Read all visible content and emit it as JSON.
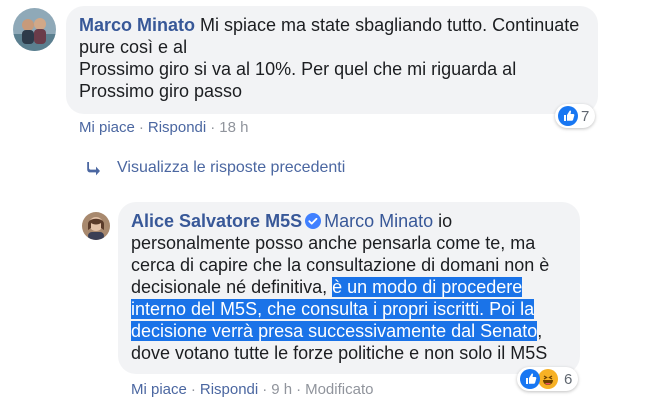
{
  "comment1": {
    "author": "Marco Minato",
    "line1": " Mi spiace ma state sbagliando tutto. Continuate",
    "line2": "pure così e al",
    "line3": "Prossimo giro si va al 10%. Per quel che mi riguarda al",
    "line4": "Prossimo giro passo",
    "reactions_count": "7",
    "actions": {
      "like": "Mi piace",
      "reply": "Rispondi",
      "time": "18 h"
    },
    "reaction_icons": [
      "like-icon"
    ]
  },
  "view_previous": {
    "label": "Visualizza le risposte precedenti",
    "icon": "reply-arrow-icon"
  },
  "comment2": {
    "author": "Alice Salvatore M5S",
    "verified_icon": "verified-badge-icon",
    "mention": "Marco Minato",
    "l1_rest": " io",
    "l2": "personalmente posso anche pensarla come te, ma",
    "l3": "cerca di capire che la consultazione di domani non è",
    "l4_plain": "decisionale né definitiva, ",
    "l4_hl": "è un modo di procedere",
    "l5_hl": "interno del M5S, che consulta i propri iscritti. Poi la",
    "l6_hl": "decisione verrà presa successivamente dal Senato",
    "l6_plain": ",",
    "l7": "dove votano tutte le forze politiche e non solo il M5S",
    "reactions_count": "6",
    "reaction_icons": [
      "like-icon",
      "haha-icon"
    ],
    "actions": {
      "like": "Mi piace",
      "reply": "Rispondi",
      "time": "9 h",
      "edited": "Modificato"
    }
  },
  "colors": {
    "link": "#385898",
    "bubble": "#f2f3f5",
    "highlight": "#1a73e8",
    "like_blue": "#1877f2"
  }
}
